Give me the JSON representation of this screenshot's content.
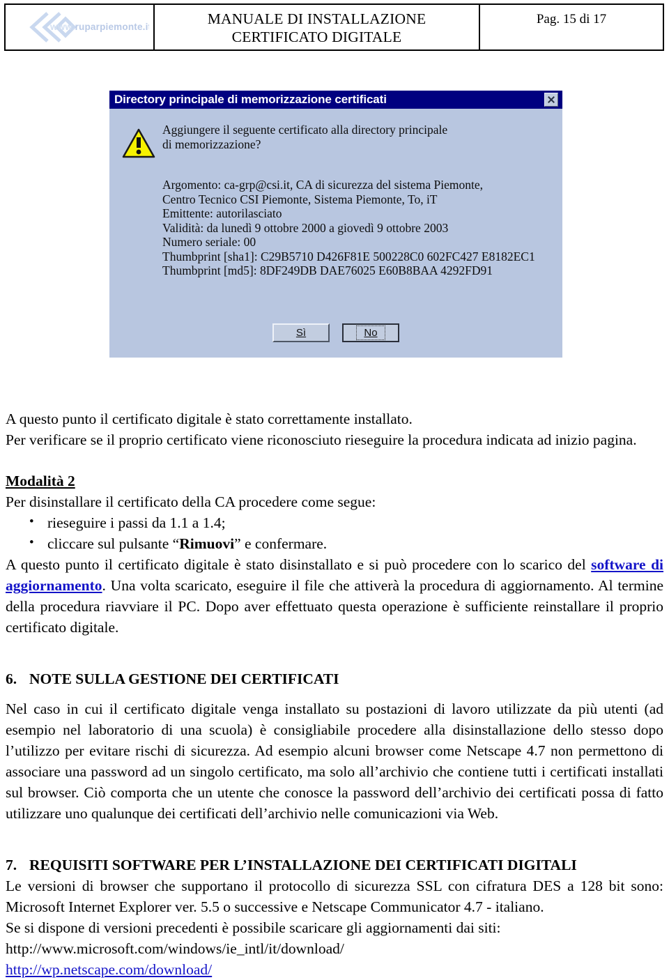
{
  "header": {
    "logo_text_dim": "www.",
    "logo_text_main": "ruparpiemonte.it",
    "title_line1": "MANUALE DI INSTALLAZIONE",
    "title_line2": "CERTIFICATO DIGITALE",
    "page_label": "Pag. 15 di 17"
  },
  "dialog": {
    "title": "Directory principale di memorizzazione certificati",
    "question": "Aggiungere il seguente certificato alla directory principale\ndi memorizzazione?",
    "details": "Argomento: ca-grp@csi.it, CA di sicurezza del sistema Piemonte,\nCentro Tecnico CSI Piemonte, Sistema Piemonte, To, iT\nEmittente: autorilasciato\nValidità: da lunedì 9 ottobre 2000 a giovedì 9 ottobre 2003\nNumero seriale: 00\nThumbprint [sha1]: C29B5710 D426F81E 500228C0 602FC427 E8182EC1\nThumbprint [md5]: 8DF249DB DAE76025 E60B8BAA 4292FD91",
    "yes_button": "Sì",
    "no_button": "No",
    "titlebar_color": "#000080",
    "face_color": "#b8c6e0"
  },
  "body": {
    "para1_line1": "A questo punto il certificato digitale è stato correttamente installato.",
    "para1_line2": "Per verificare se il proprio certificato viene riconosciuto rieseguire la procedura indicata ad inizio pagina.",
    "modalita_heading": "Modalità 2",
    "modalita_intro": "Per disinstallare il certificato della CA procedere come segue:",
    "bullet1": "rieseguire i passi da 1.1 a 1.4;",
    "bullet2_pre": "cliccare sul pulsante “",
    "bullet2_bold": "Rimuovi",
    "bullet2_post": "” e confermare.",
    "para2_pre": "A questo punto il certificato digitale è stato disinstallato e si può procedere con lo scarico del ",
    "para2_link": "software di aggiornamento",
    "para2_post": ". Una volta scaricato, eseguire il file che attiverà la procedura di aggiornamento. Al termine della procedura riavviare il PC. Dopo aver effettuato questa operazione è sufficiente reinstallare il proprio certificato digitale."
  },
  "section6": {
    "number": "6.",
    "title": "NOTE SULLA GESTIONE DEI CERTIFICATI",
    "paragraph": "Nel caso in cui il certificato digitale venga installato su postazioni di lavoro utilizzate da più utenti (ad esempio nel laboratorio di una scuola) è consigliabile procedere alla disinstallazione dello stesso dopo l’utilizzo per evitare rischi di sicurezza. Ad esempio alcuni browser come Netscape 4.7 non permettono di associare una password ad un singolo certificato, ma solo all’archivio che contiene tutti i certificati installati sul browser. Ciò comporta che un utente che conosce la password dell’archivio dei certificati possa di fatto utilizzare uno qualunque dei certificati dell’archivio nelle comunicazioni via Web."
  },
  "section7": {
    "number": "7.",
    "title": "REQUISITI SOFTWARE PER L’INSTALLAZIONE DEI CERTIFICATI DIGITALI",
    "paragraph": "Le versioni di browser che supportano il protocollo di sicurezza SSL con cifratura DES a 128 bit sono: Microsoft Internet Explorer ver. 5.5 o successive e Netscape Communicator 4.7 - italiano.",
    "paragraph2": "Se si dispone di versioni precedenti è possibile scaricare gli aggiornamenti dai siti:",
    "url1": "http://www.microsoft.com/windows/ie_intl/it/download/",
    "url2": "http://wp.netscape.com/download/"
  }
}
